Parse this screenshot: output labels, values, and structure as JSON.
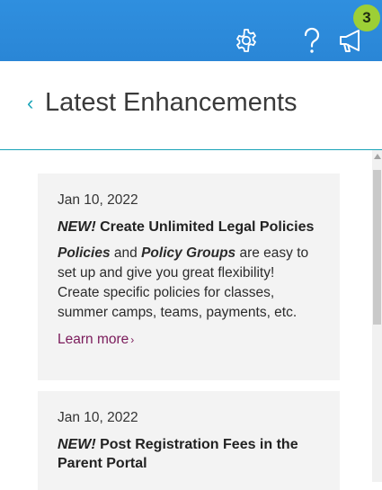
{
  "header": {
    "badge_count": "3",
    "back_glyph": "‹",
    "title": "Latest Enhancements",
    "bar_color": "#2a86d6",
    "badge_color": "#9dcf36",
    "icons": [
      "gear-icon",
      "help-icon",
      "megaphone-icon",
      "pointer-hand-icon"
    ]
  },
  "entries": [
    {
      "date": "Jan 10, 2022",
      "new_tag": "NEW!",
      "title": "Create Unlimited Legal Policies",
      "body_part1": "Policies",
      "body_part2": " and ",
      "body_part3": "Policy Groups",
      "body_part4": " are easy to set up and give you great flexibility! Create specific policies for classes, summer camps, teams, payments, etc.",
      "link_label": "Learn more",
      "link_chevron": "›"
    },
    {
      "date": "Jan 10, 2022",
      "new_tag": "NEW!",
      "title": "Post Registration Fees in the Parent Portal"
    }
  ]
}
